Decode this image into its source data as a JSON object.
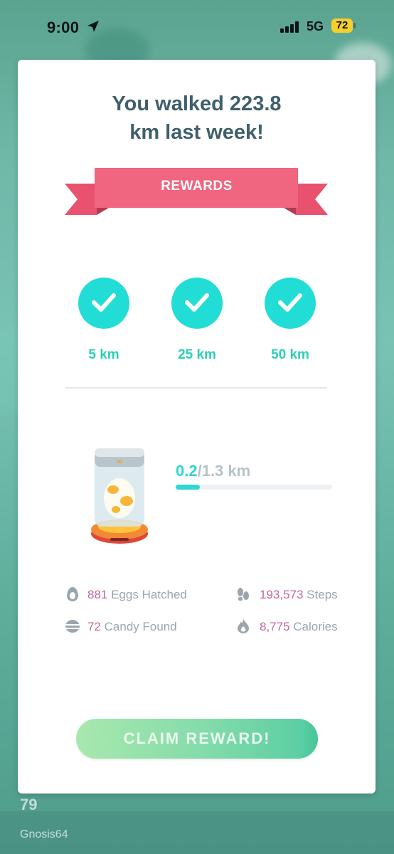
{
  "status_bar": {
    "time": "9:00",
    "network": "5G",
    "battery": "72"
  },
  "dialog": {
    "title_line1": "You walked 223.8",
    "title_line2": "km last week!",
    "rewards_label": "REWARDS",
    "milestones": [
      {
        "label": "5 km",
        "completed": true
      },
      {
        "label": "25 km",
        "completed": true
      },
      {
        "label": "50 km",
        "completed": true
      }
    ],
    "egg_progress": {
      "current": "0.2",
      "total": "/1.3 km",
      "fraction": 0.154
    },
    "stats": [
      {
        "value": "881",
        "label": " Eggs Hatched",
        "icon": "egg-icon"
      },
      {
        "value": "193,573",
        "label": " Steps",
        "icon": "footsteps-icon"
      },
      {
        "value": "72",
        "label": " Candy Found",
        "icon": "candy-icon"
      },
      {
        "value": "8,775",
        "label": " Calories",
        "icon": "flame-icon"
      }
    ],
    "claim_button": "CLAIM REWARD!"
  },
  "background": {
    "player_level": "79",
    "player_name": "Gnosis64"
  },
  "colors": {
    "accent_teal": "#22ddd5",
    "ribbon_pink": "#f0657f",
    "title_slate": "#3f5f6c",
    "stat_number": "#c3679c"
  }
}
